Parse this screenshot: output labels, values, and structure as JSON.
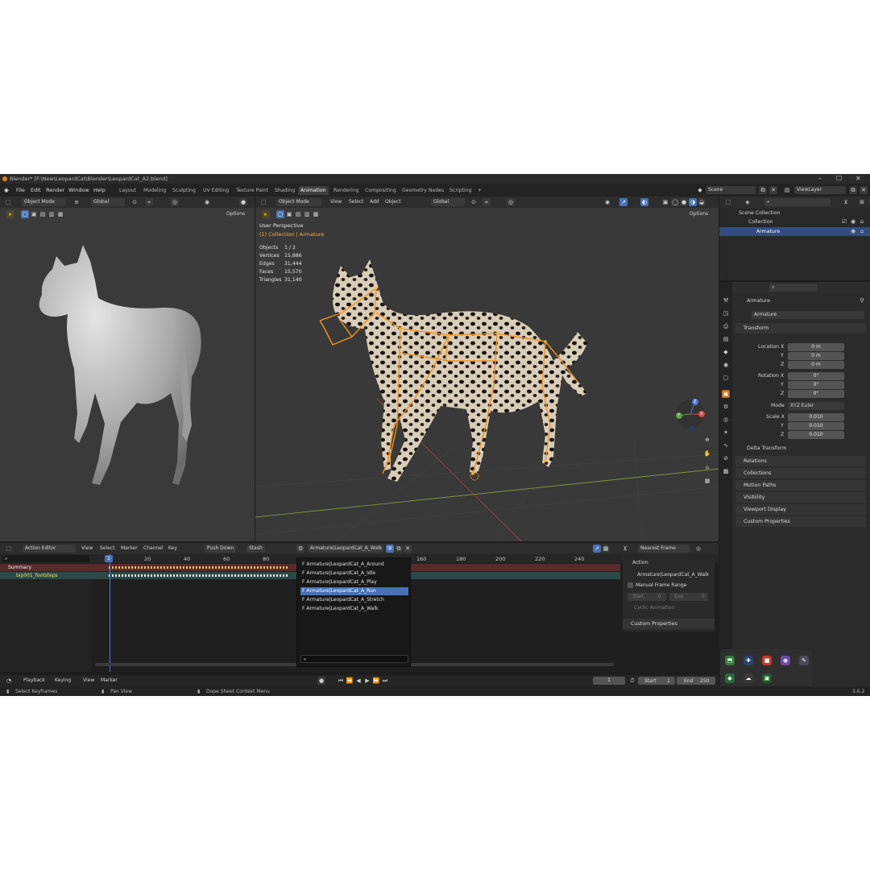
{
  "window": {
    "title": "Blender* [F:\\New\\LeopardCat\\Blender\\LeopardCat_A2.blend]",
    "minimize": "–",
    "maximize": "☐",
    "close": "✕"
  },
  "menu": [
    "File",
    "Edit",
    "Render",
    "Window",
    "Help"
  ],
  "workspaces": [
    "Layout",
    "Modeling",
    "Sculpting",
    "UV Editing",
    "Texture Paint",
    "Shading",
    "Animation",
    "Rendering",
    "Compositing",
    "Geometry Nodes",
    "Scripting",
    "+"
  ],
  "active_workspace": "Animation",
  "scene": {
    "scene_name": "Scene",
    "view_layer": "ViewLayer"
  },
  "left_viewport": {
    "mode": "Object Mode",
    "orientation": "Global",
    "options": "Options"
  },
  "main_viewport": {
    "mode": "Object Mode",
    "menus": [
      "View",
      "Select",
      "Add",
      "Object"
    ],
    "orientation": "Global",
    "options": "Options",
    "perspective": "User Perspective",
    "collection_info": "(1) Collection | Armature",
    "stats": [
      {
        "label": "Objects",
        "value": "1 / 2"
      },
      {
        "label": "Vertices",
        "value": "15,886"
      },
      {
        "label": "Edges",
        "value": "31,444"
      },
      {
        "label": "Faces",
        "value": "15,570"
      },
      {
        "label": "Triangles",
        "value": "31,140"
      }
    ],
    "gizmo": {
      "z": "Z",
      "y": "Y",
      "x": "X"
    }
  },
  "outliner": {
    "scene_collection": "Scene Collection",
    "collection": "Collection",
    "armature": "Armature"
  },
  "properties": {
    "object_name": "Armature",
    "data_name": "Armature",
    "transform_label": "Transform",
    "location": {
      "label": "Location X",
      "x": "0 m",
      "y": "0 m",
      "z": "0 m"
    },
    "rotation": {
      "label": "Rotation X",
      "x": "0°",
      "y": "0°",
      "z": "0°"
    },
    "mode_label": "Mode",
    "mode_value": "XYZ Euler",
    "scale": {
      "label": "Scale X",
      "x": "0.010",
      "y": "0.010",
      "z": "0.010"
    },
    "axis_y": "Y",
    "axis_z": "Z",
    "sections": [
      "Delta Transform",
      "Relations",
      "Collections",
      "Motion Paths",
      "Visibility",
      "Viewport Display",
      "Custom Properties"
    ]
  },
  "dopesheet": {
    "editor": "Action Editor",
    "menus": [
      "View",
      "Select",
      "Marker",
      "Channel",
      "Key"
    ],
    "push_down": "Push Down",
    "stash": "Stash",
    "action": "Armature|LeopardCat_A_Walk",
    "snap": "Nearest Frame",
    "current_frame_badge": "1",
    "ticks": [
      "20",
      "40",
      "60",
      "80",
      "160",
      "180",
      "200",
      "220",
      "240"
    ],
    "channels": {
      "summary": "Summary",
      "object": "bip001_footsteps"
    },
    "actions_list": [
      "F Armature|LeopardCat_A_Around",
      "F Armature|LeopardCat_A_Idle",
      "F Armature|LeopardCat_A_Play",
      "F Armature|LeopardCat_A_Run",
      "F Armature|LeopardCat_A_Stretch",
      "F Armature|LeopardCat_A_Walk"
    ],
    "selected_action_index": 3,
    "side_panel": {
      "title": "Action",
      "action_name": "Armature|LeopardCat_A_Walk",
      "manual_range": "Manual Frame Range",
      "start_label": "Start",
      "start_value": "0",
      "end_label": "End",
      "end_value": "0",
      "cyclic": "Cyclic Animation",
      "custom_props": "Custom Properties"
    }
  },
  "playback": {
    "menus": [
      "Playback",
      "Keying",
      "View",
      "Marker"
    ],
    "current_frame": "1",
    "start_label": "Start",
    "start": "1",
    "end_label": "End",
    "end": "250"
  },
  "status": {
    "left": "Select Keyframes",
    "middle": "Pan View",
    "right": "Dope Sheet Context Menu",
    "version": "3.6.2"
  }
}
